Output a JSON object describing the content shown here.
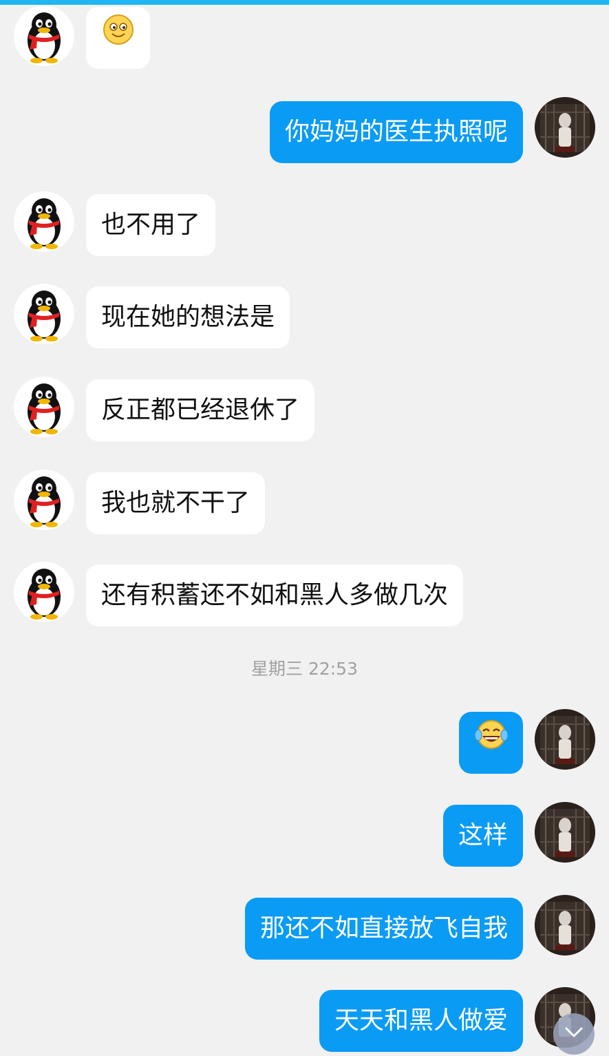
{
  "messages": [
    {
      "side": "in",
      "type": "emoji",
      "emoji": "smile-emoji"
    },
    {
      "side": "out",
      "type": "text",
      "text": "你妈妈的医生执照呢"
    },
    {
      "side": "in",
      "type": "text",
      "text": "也不用了"
    },
    {
      "side": "in",
      "type": "text",
      "text": "现在她的想法是"
    },
    {
      "side": "in",
      "type": "text",
      "text": "反正都已经退休了"
    },
    {
      "side": "in",
      "type": "text",
      "text": "我也就不干了"
    },
    {
      "side": "in",
      "type": "text",
      "text": "还有积蓄还不如和黑人多做几次"
    },
    {
      "side": "out",
      "type": "emoji",
      "emoji": "tears-of-joy-emoji"
    },
    {
      "side": "out",
      "type": "text",
      "text": "这样"
    },
    {
      "side": "out",
      "type": "text",
      "text": "那还不如直接放飞自我"
    },
    {
      "side": "out",
      "type": "text",
      "text": "天天和黑人做爱"
    }
  ],
  "timestamp": "星期三 22:53",
  "colors": {
    "accent_bar": "#1fb6f2",
    "outgoing_bubble": "#0a9bf5",
    "incoming_bubble": "#ffffff",
    "background": "#f1f1f1"
  },
  "icons": {
    "contact_avatar": "penguin-avatar-icon",
    "self_avatar": "photo-avatar-icon",
    "scroll_button": "chevron-down-icon"
  }
}
